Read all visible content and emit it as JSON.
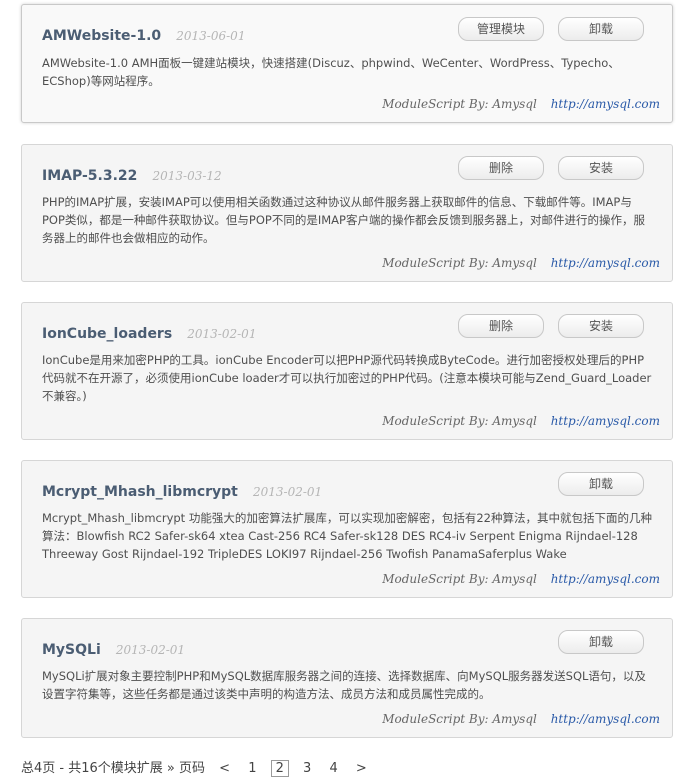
{
  "modules": [
    {
      "name": "AMWebsite-1.0",
      "date": "2013-06-01",
      "buttons": [
        "管理模块",
        "卸载"
      ],
      "description": "AMWebsite-1.0 AMH面板一键建站模块，快速搭建(Discuz、phpwind、WeCenter、WordPress、Typecho、ECShop)等网站程序。",
      "author": "ModuleScript By: Amysql",
      "url": "http://amysql.com"
    },
    {
      "name": "IMAP-5.3.22",
      "date": "2013-03-12",
      "buttons": [
        "删除",
        "安装"
      ],
      "description": "PHP的IMAP扩展，安装IMAP可以使用相关函数通过这种协议从邮件服务器上获取邮件的信息、下载邮件等。IMAP与POP类似，都是一种邮件获取协议。但与POP不同的是IMAP客户端的操作都会反馈到服务器上，对邮件进行的操作，服务器上的邮件也会做相应的动作。",
      "author": "ModuleScript By: Amysql",
      "url": "http://amysql.com"
    },
    {
      "name": "IonCube_loaders",
      "date": "2013-02-01",
      "buttons": [
        "删除",
        "安装"
      ],
      "description": "IonCube是用来加密PHP的工具。ionCube Encoder可以把PHP源代码转换成ByteCode。进行加密授权处理后的PHP代码就不在开源了，必须使用ionCube loader才可以执行加密过的PHP代码。(注意本模块可能与Zend_Guard_Loader不兼容。)",
      "author": "ModuleScript By: Amysql",
      "url": "http://amysql.com"
    },
    {
      "name": "Mcrypt_Mhash_libmcrypt",
      "date": "2013-02-01",
      "buttons": [
        "卸载"
      ],
      "description": "Mcrypt_Mhash_libmcrypt 功能强大的加密算法扩展库，可以实现加密解密，包括有22种算法，其中就包括下面的几种算法：Blowfish RC2 Safer-sk64 xtea Cast-256 RC4 Safer-sk128 DES RC4-iv Serpent Enigma Rijndael-128 Threeway Gost Rijndael-192 TripleDES LOKI97 Rijndael-256 Twofish PanamaSaferplus Wake",
      "author": "ModuleScript By: Amysql",
      "url": "http://amysql.com"
    },
    {
      "name": "MySQLi",
      "date": "2013-02-01",
      "buttons": [
        "卸载"
      ],
      "description": "MySQLi扩展对象主要控制PHP和MySQL数据库服务器之间的连接、选择数据库、向MySQL服务器发送SQL语句，以及设置字符集等，这些任务都是通过该类中声明的构造方法、成员方法和成员属性完成的。",
      "author": "ModuleScript By: Amysql",
      "url": "http://amysql.com"
    }
  ],
  "pagination": {
    "summary": "总4页 - 共16个模块扩展 » 页码",
    "prev": "<",
    "pages": [
      "1",
      "2",
      "3",
      "4"
    ],
    "current": "2",
    "next": ">"
  }
}
